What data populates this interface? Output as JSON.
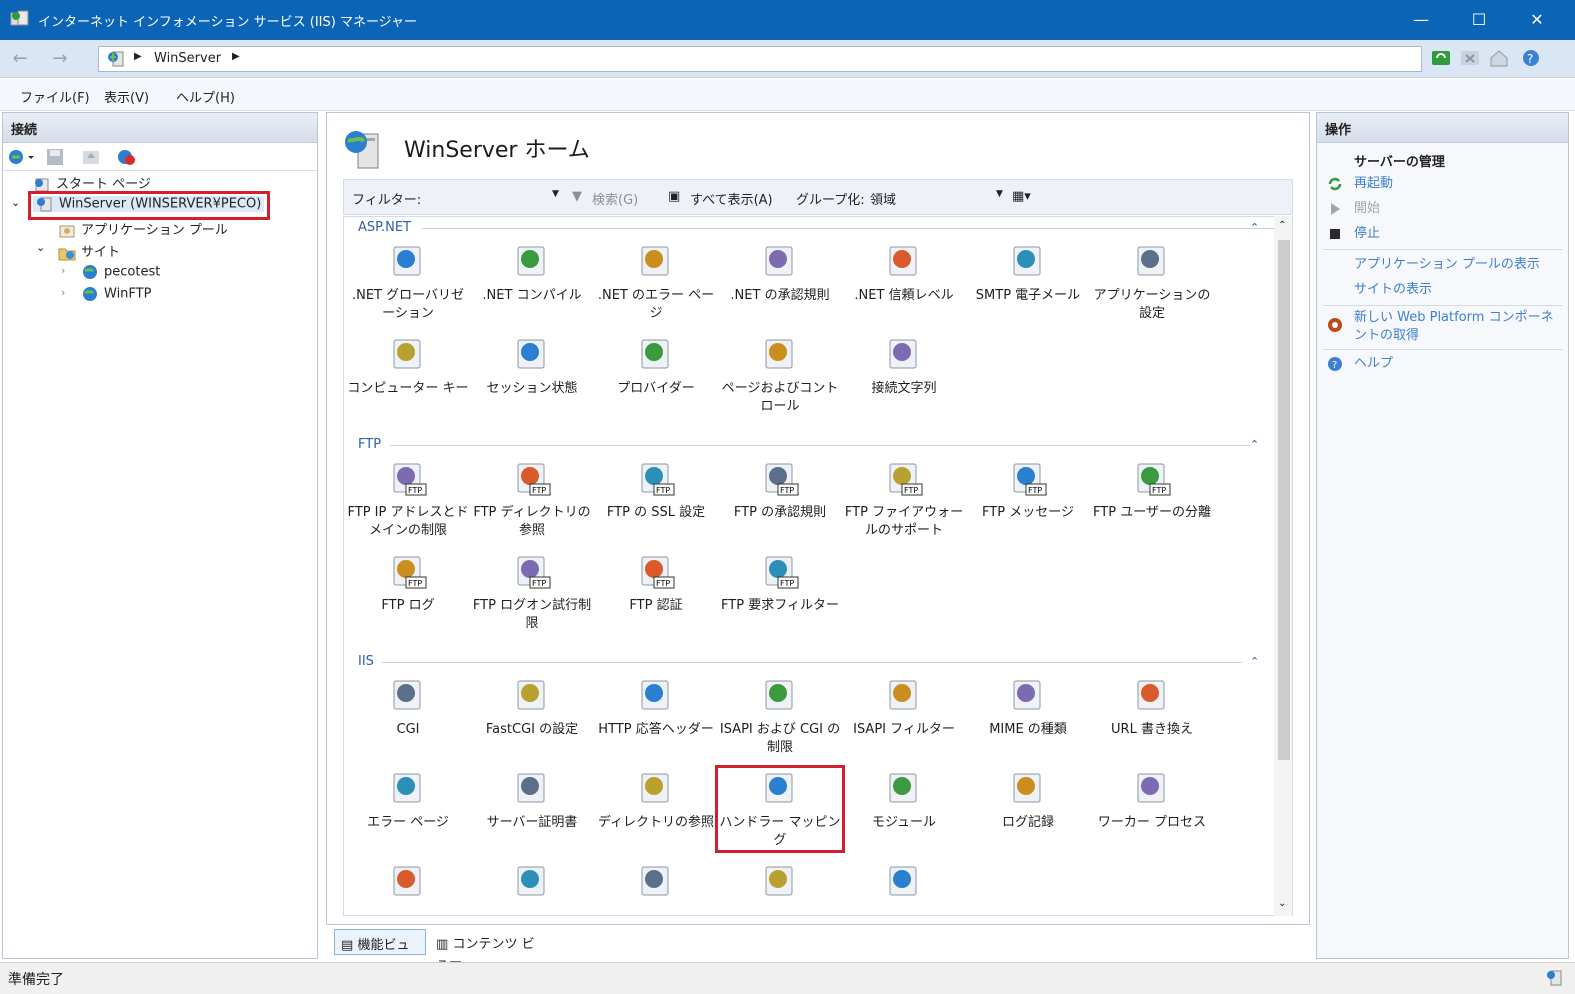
{
  "window": {
    "title": "インターネット インフォメーション サービス (IIS) マネージャー",
    "minimize": "—",
    "maximize": "☐",
    "close": "✕"
  },
  "address": {
    "crumb": "WinServer",
    "sep1": "▶",
    "sep2": "▶"
  },
  "menu": [
    "ファイル(F)",
    "表示(V)",
    "ヘルプ(H)"
  ],
  "connections": {
    "title": "接続",
    "tree": [
      {
        "label": "スタート ページ",
        "icon": "start-page-icon"
      },
      {
        "label": "WinServer (WINSERVER¥PECO)",
        "icon": "server-icon",
        "selected": true
      },
      {
        "label": "アプリケーション プール",
        "icon": "app-pool-icon"
      },
      {
        "label": "サイト",
        "icon": "sites-folder-icon"
      },
      {
        "label": "pecotest",
        "icon": "globe-icon"
      },
      {
        "label": "WinFTP",
        "icon": "globe-icon"
      }
    ]
  },
  "center": {
    "title": "WinServer ホーム",
    "filter_label": "フィルター:",
    "search_label": "検索(G)",
    "show_all_label": "すべて表示(A)",
    "group_label": "グループ化:",
    "group_value": "領域",
    "sections": [
      {
        "name": "ASP.NET",
        "items": [
          ".NET グローバリゼーション",
          ".NET コンパイル",
          ".NET のエラー ページ",
          ".NET の承認規則",
          ".NET 信頼レベル",
          "SMTP 電子メール",
          "アプリケーションの設定",
          "コンピューター キー",
          "セッション状態",
          "プロバイダー",
          "ページおよびコントロール",
          "接続文字列"
        ]
      },
      {
        "name": "FTP",
        "items": [
          "FTP IP アドレスとドメインの制限",
          "FTP ディレクトリの参照",
          "FTP の SSL 設定",
          "FTP の承認規則",
          "FTP ファイアウォールのサポート",
          "FTP メッセージ",
          "FTP ユーザーの分離",
          "FTP ログ",
          "FTP ログオン試行制限",
          "FTP 認証",
          "FTP 要求フィルター"
        ]
      },
      {
        "name": "IIS",
        "items": [
          "CGI",
          "FastCGI の設定",
          "HTTP 応答ヘッダー",
          "ISAPI および CGI の制限",
          "ISAPI フィルター",
          "MIME の種類",
          "URL 書き換え",
          "エラー ページ",
          "サーバー証明書",
          "ディレクトリの参照",
          "ハンドラー マッピング",
          "モジュール",
          "ログ記録",
          "ワーカー プロセス",
          "",
          "",
          "",
          "",
          ""
        ]
      }
    ],
    "selected_item": "ハンドラー マッピング",
    "tabs": [
      "機能ビュー",
      "コンテンツ ビュー"
    ]
  },
  "actions": {
    "title": "操作",
    "group": "サーバーの管理",
    "items": [
      "再起動",
      "開始",
      "停止",
      "アプリケーション プールの表示",
      "サイトの表示",
      "新しい Web Platform コンポーネントの取得",
      "ヘルプ"
    ]
  },
  "status": "準備完了",
  "colors": {
    "titlebar": "#0b64b5",
    "link": "#3d7fd3",
    "highlight": "#d61f2c"
  }
}
